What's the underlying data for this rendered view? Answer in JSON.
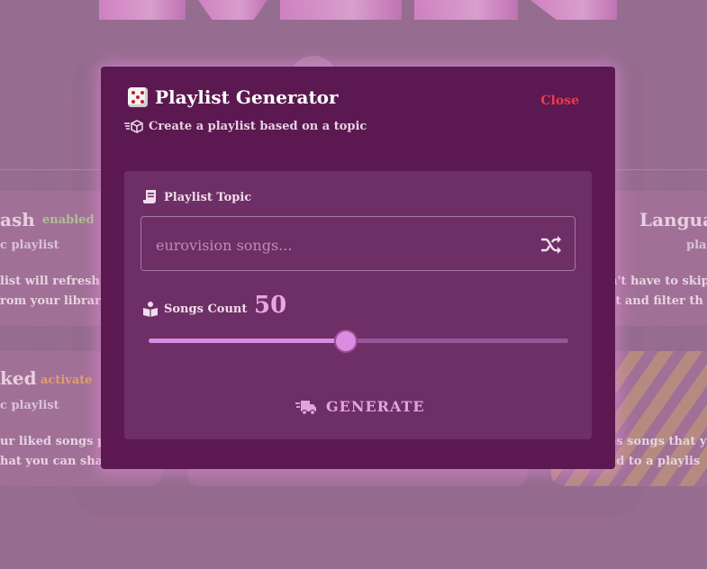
{
  "background": {
    "cards": [
      {
        "title": "ash",
        "badge": "enabled",
        "badge_color": "#bdd59a",
        "sub": "c playlist",
        "desc": [
          "list will refresh",
          "rom your library"
        ]
      },
      {
        "title": "ked",
        "badge": "activate",
        "badge_color": "#f2b06a",
        "sub": "c playlist",
        "desc": [
          "ur liked songs p",
          "hat you can sha"
        ]
      },
      {
        "title": "Langua",
        "sub": "pla",
        "desc": [
          "n't have to skip",
          "st and filter th"
        ]
      },
      {
        "title": "",
        "sub": "",
        "desc": [
          "es songs that y",
          "ed to a playlis"
        ]
      }
    ]
  },
  "modal": {
    "title": "Playlist Generator",
    "close_label": "Close",
    "subtitle": "Create a playlist based on a topic",
    "topic": {
      "label": "Playlist Topic",
      "placeholder": "eurovision songs...",
      "value": ""
    },
    "songs_count": {
      "label": "Songs Count",
      "value": "50",
      "slider_fraction": 0.47
    },
    "generate_label": "GENERATE"
  },
  "colors": {
    "modal_bg": "#5c1850",
    "panel_bg": "#6e2e66",
    "accent": "#dc8be2",
    "close": "#ef3a4a"
  }
}
